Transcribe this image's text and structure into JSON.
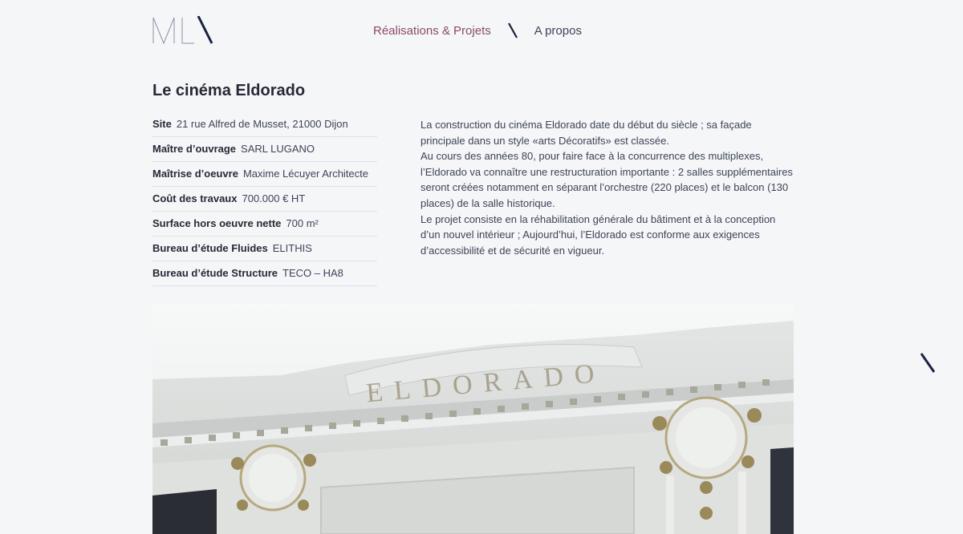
{
  "logo": {
    "alt": "MLA"
  },
  "nav": {
    "items": [
      {
        "label": "Réalisations & Projets",
        "active": true
      },
      {
        "label": "A propos",
        "active": false
      }
    ]
  },
  "page": {
    "title": "Le cinéma Eldorado"
  },
  "specs": [
    {
      "label": "Site",
      "value": "21 rue Alfred de Musset, 21000 Dijon"
    },
    {
      "label": "Maître d’ouvrage",
      "value": "SARL LUGANO"
    },
    {
      "label": "Maîtrise d’oeuvre",
      "value": "Maxime Lécuyer Architecte"
    },
    {
      "label": "Coût des travaux",
      "value": "700.000 € HT"
    },
    {
      "label": "Surface hors oeuvre nette",
      "value": "700 m²"
    },
    {
      "label": "Bureau d’étude Fluides",
      "value": "ELITHIS"
    },
    {
      "label": "Bureau d’étude Structure",
      "value": "TECO – HA8"
    }
  ],
  "description": [
    "La construction du cinéma Eldorado date du début du siècle ; sa façade principale dans un style «arts Décoratifs» est classée.",
    "Au cours des années 80, pour faire face à la concurrence des multiplexes, l’Eldorado va connaître une restructuration importante : 2 salles supplémentaires seront créées notamment en séparant l’orchestre (220 places) et le balcon (130 places) de la salle historique.",
    "Le projet consiste en la réhabilitation générale du bâtiment et à la conception d’un nouvel intérieur ; Aujourd’hui, l’Eldorado est conforme aux exigences d’accessibilité et de sécurité en vigueur."
  ],
  "photo": {
    "sign_text": "ELDORADO"
  },
  "colors": {
    "background": "#f5f6f8",
    "accent": "#8a4a6a",
    "text": "#2c3140",
    "logo": "#1a2440"
  }
}
